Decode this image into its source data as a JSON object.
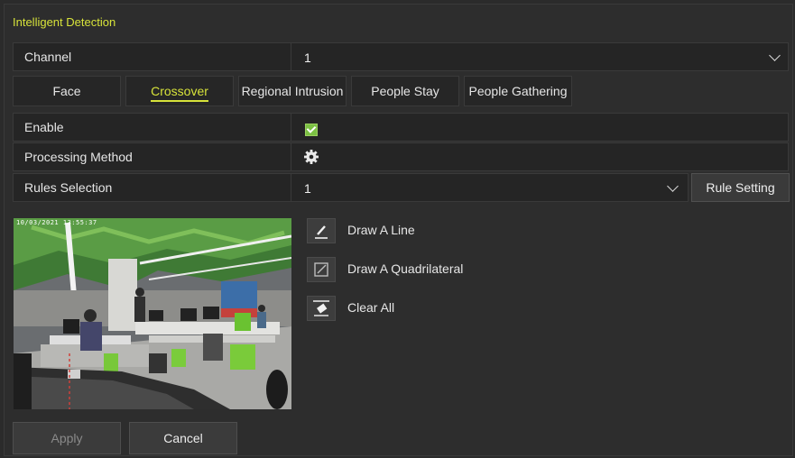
{
  "title": "Intelligent Detection",
  "channel": {
    "label": "Channel",
    "value": "1"
  },
  "tabs": [
    {
      "label": "Face",
      "active": false
    },
    {
      "label": "Crossover",
      "active": true
    },
    {
      "label": "Regional Intrusion",
      "active": false
    },
    {
      "label": "People Stay",
      "active": false
    },
    {
      "label": "People Gathering",
      "active": false
    }
  ],
  "enable": {
    "label": "Enable",
    "checked": true
  },
  "processing": {
    "label": "Processing Method"
  },
  "rules": {
    "label": "Rules Selection",
    "value": "1",
    "button": "Rule Setting"
  },
  "preview": {
    "timestamp": "10/03/2021 13:55:37"
  },
  "tools": {
    "draw_line": "Draw A Line",
    "draw_quad": "Draw A Quadrilateral",
    "clear_all": "Clear All"
  },
  "footer": {
    "apply": "Apply",
    "cancel": "Cancel"
  },
  "colors": {
    "accent": "#d7e33a",
    "check": "#7bc043"
  }
}
